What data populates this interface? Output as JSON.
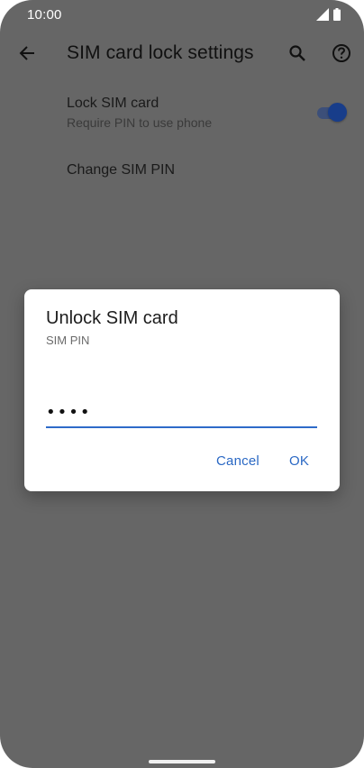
{
  "status_bar": {
    "time": "10:00",
    "icons": [
      "cellular-signal-icon",
      "battery-icon"
    ]
  },
  "app_bar": {
    "title": "SIM card lock settings",
    "back_icon": "arrow-back-icon",
    "search_icon": "search-icon",
    "help_icon": "help-icon"
  },
  "settings": {
    "lock_sim": {
      "title": "Lock SIM card",
      "summary": "Require PIN to use phone",
      "enabled": true
    },
    "change_pin": {
      "title": "Change SIM PIN"
    }
  },
  "dialog": {
    "title": "Unlock SIM card",
    "subtitle": "SIM PIN",
    "pin_value": "••••",
    "cancel_label": "Cancel",
    "ok_label": "OK"
  },
  "colors": {
    "scrim_background": "#666666",
    "accent": "#2a68c4",
    "toggle_thumb": "#183d8a"
  }
}
